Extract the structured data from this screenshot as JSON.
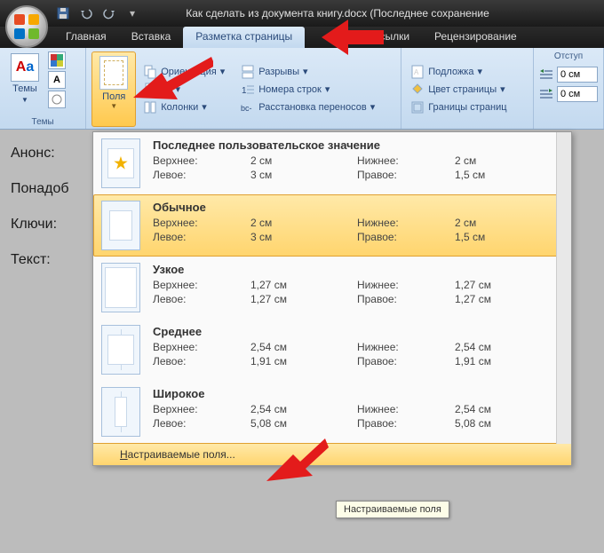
{
  "titlebar": {
    "doc_title": "Как сделать из документа книгу.docx (Последнее сохранение"
  },
  "tabs": {
    "home": "Главная",
    "insert": "Вставка",
    "layout": "Разметка страницы",
    "mailings": "Рассылки",
    "review": "Рецензирование"
  },
  "ribbon": {
    "themes_group": "Темы",
    "themes_btn": "Темы",
    "margins_btn": "Поля",
    "orientation": "Ориентация",
    "size": "ер",
    "columns": "Колонки",
    "breaks": "Разрывы",
    "line_numbers": "Номера строк",
    "hyphenation": "Расстановка переносов",
    "watermark": "Подложка",
    "page_color": "Цвет страницы",
    "borders": "Границы страниц",
    "indent_group": "Отступ",
    "indent_left": "0 см",
    "indent_right": "0 см"
  },
  "document": {
    "line1": "Анонс:",
    "line2": "Понадоб",
    "line3": "Ключи:",
    "line4": "Текст:"
  },
  "margins_menu": {
    "items": [
      {
        "title": "Последнее пользовательское значение",
        "top_lbl": "Верхнее:",
        "top_val": "2 см",
        "bottom_lbl": "Нижнее:",
        "bottom_val": "2 см",
        "left_lbl": "Левое:",
        "left_val": "3 см",
        "right_lbl": "Правое:",
        "right_val": "1,5 см"
      },
      {
        "title": "Обычное",
        "top_lbl": "Верхнее:",
        "top_val": "2 см",
        "bottom_lbl": "Нижнее:",
        "bottom_val": "2 см",
        "left_lbl": "Левое:",
        "left_val": "3 см",
        "right_lbl": "Правое:",
        "right_val": "1,5 см"
      },
      {
        "title": "Узкое",
        "top_lbl": "Верхнее:",
        "top_val": "1,27 см",
        "bottom_lbl": "Нижнее:",
        "bottom_val": "1,27 см",
        "left_lbl": "Левое:",
        "left_val": "1,27 см",
        "right_lbl": "Правое:",
        "right_val": "1,27 см"
      },
      {
        "title": "Среднее",
        "top_lbl": "Верхнее:",
        "top_val": "2,54 см",
        "bottom_lbl": "Нижнее:",
        "bottom_val": "2,54 см",
        "left_lbl": "Левое:",
        "left_val": "1,91 см",
        "right_lbl": "Правое:",
        "right_val": "1,91 см"
      },
      {
        "title": "Широкое",
        "top_lbl": "Верхнее:",
        "top_val": "2,54 см",
        "bottom_lbl": "Нижнее:",
        "bottom_val": "2,54 см",
        "left_lbl": "Левое:",
        "left_val": "5,08 см",
        "right_lbl": "Правое:",
        "right_val": "5,08 см"
      }
    ],
    "custom": "Настраиваемые поля...",
    "custom_initial": "Н"
  },
  "tooltip": "Настраиваемые поля"
}
